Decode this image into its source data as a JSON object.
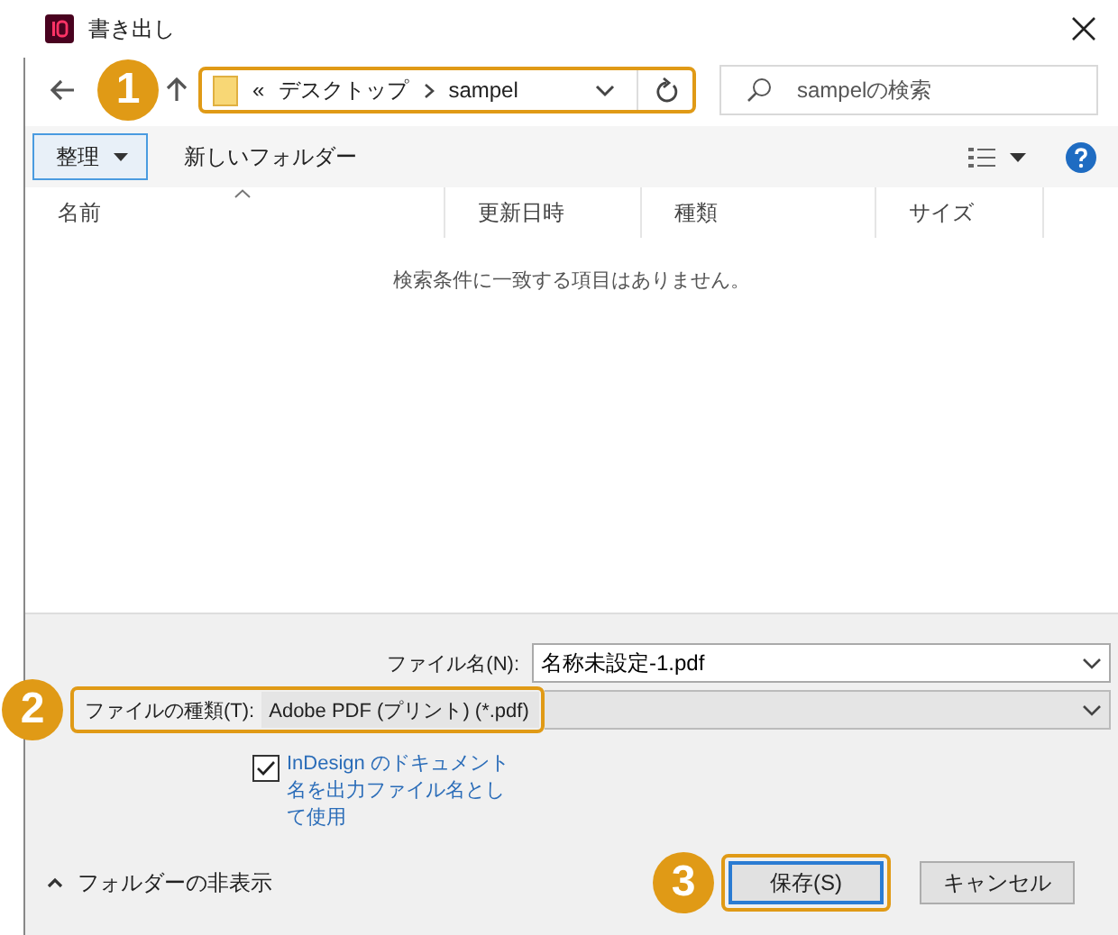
{
  "window": {
    "title": "書き出し"
  },
  "nav": {
    "callout": "1",
    "overflow": "«",
    "path": [
      "デスクトップ",
      "sampel"
    ],
    "search": {
      "placeholder": "sampelの検索"
    }
  },
  "toolbar": {
    "organize": "整理",
    "new_folder": "新しいフォルダー"
  },
  "columns": [
    {
      "label": "名前",
      "sorted": true
    },
    {
      "label": "更新日時",
      "sorted": false
    },
    {
      "label": "種類",
      "sorted": false
    },
    {
      "label": "サイズ",
      "sorted": false
    }
  ],
  "empty_message": "検索条件に一致する項目はありません。",
  "fields": [
    {
      "kind": "editable",
      "label": "ファイル名(N):",
      "value": "名称未設定-1.pdf"
    },
    {
      "kind": "select",
      "label": "ファイルの種類(T):",
      "value": "Adobe PDF (プリント) (*.pdf)",
      "callout": "2"
    }
  ],
  "option": {
    "label": "InDesign のドキュメント名を出力ファイル名として使用",
    "checked": true
  },
  "hide_folders": "フォルダーの非表示",
  "buttons": [
    {
      "label": "保存(S)",
      "primary": true,
      "callout": "3"
    },
    {
      "label": "キャンセル",
      "primary": false
    }
  ]
}
